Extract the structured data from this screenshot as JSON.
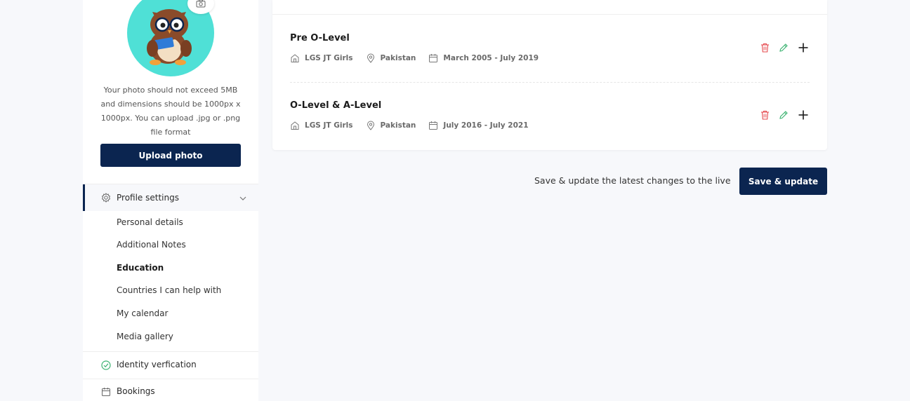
{
  "sidebar": {
    "photo_note": "Your photo should not exceed 5MB and dimensions should be 1000px x 1000px. You can upload .jpg or .png file format",
    "upload_label": "Upload photo",
    "profile_settings_label": "Profile settings",
    "sub_items": [
      {
        "label": "Personal details"
      },
      {
        "label": "Additional Notes"
      },
      {
        "label": "Education"
      },
      {
        "label": "Countries I can help with"
      },
      {
        "label": "My calendar"
      },
      {
        "label": "Media gallery"
      }
    ],
    "identity_label": "Identity verfication",
    "bookings_label": "Bookings"
  },
  "education": [
    {
      "title": "Pre O-Level",
      "school": "LGS JT Girls",
      "country": "Pakistan",
      "dates": "March 2005 - July 2019"
    },
    {
      "title": "O-Level & A-Level",
      "school": "LGS JT Girls",
      "country": "Pakistan",
      "dates": "July 2016 - July 2021"
    }
  ],
  "footer": {
    "save_note": "Save & update the latest changes to the live",
    "save_label": "Save & update"
  },
  "colors": {
    "primary": "#0b2550",
    "avatar_bg": "#4fe0d6",
    "delete": "#e5484d",
    "edit": "#3cb371",
    "verified": "#3cb371"
  }
}
